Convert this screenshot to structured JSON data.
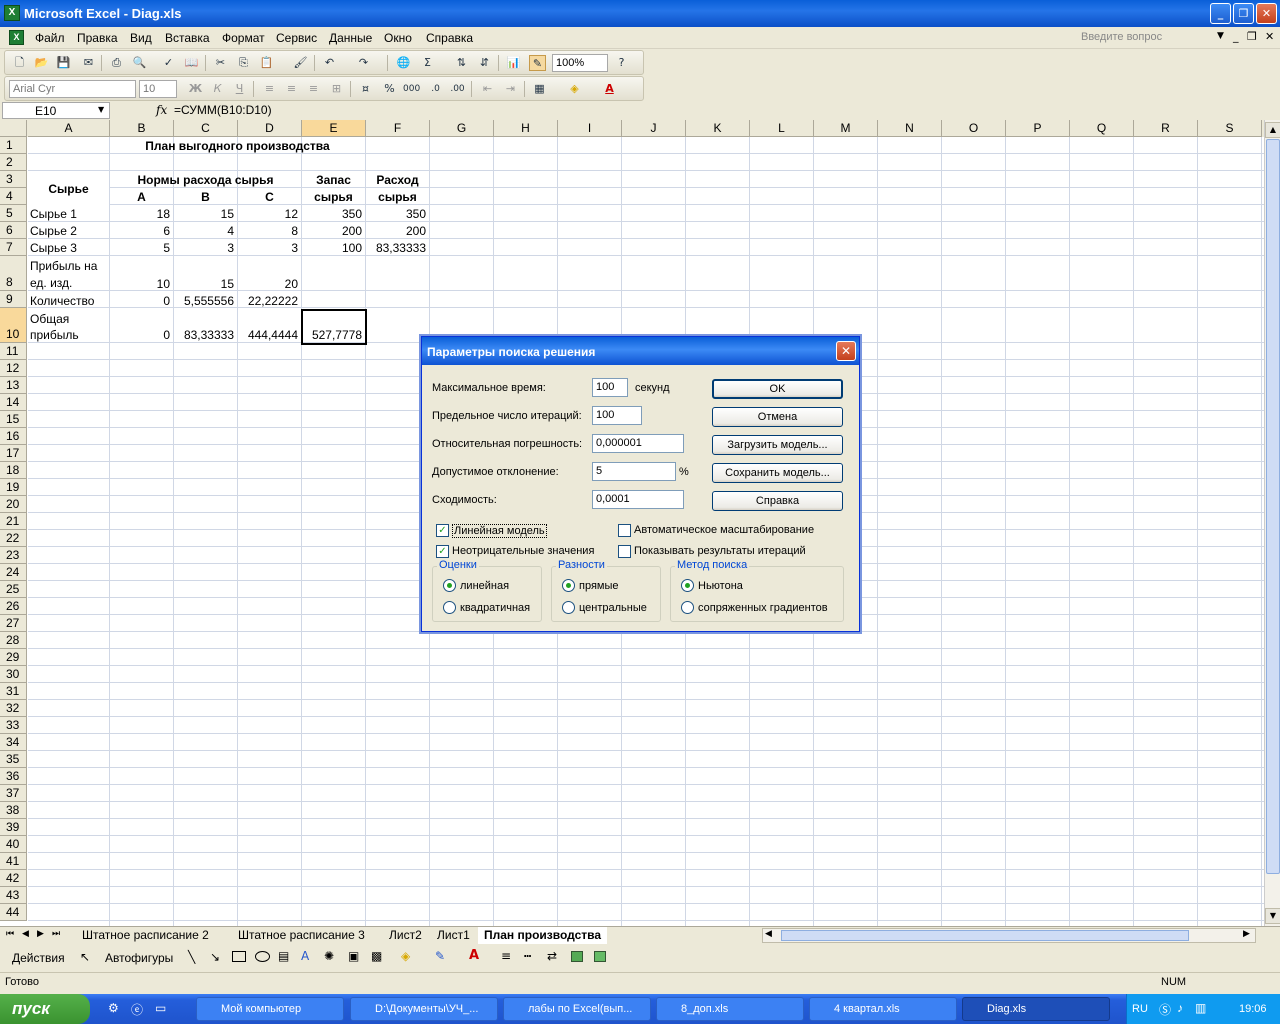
{
  "window": {
    "title": "Microsoft Excel - Diag.xls",
    "min": "_",
    "restore": "❐",
    "close": "✕"
  },
  "menu": {
    "items": [
      "Файл",
      "Правка",
      "Вид",
      "Вставка",
      "Формат",
      "Сервис",
      "Данные",
      "Окно",
      "Справка"
    ],
    "ask_placeholder": "Введите вопрос"
  },
  "toolbar": {
    "zoom": "100%",
    "font": "Arial Cyr",
    "size": "10",
    "bold": "Ж",
    "italic": "К",
    "underline": "Ч",
    "percent": "%",
    "thousands": "000",
    "sigma": "Σ"
  },
  "formula_bar": {
    "name_box": "E10",
    "fx": "fx",
    "formula": "=СУММ(B10:D10)"
  },
  "columns": [
    "A",
    "B",
    "C",
    "D",
    "E",
    "F",
    "G",
    "H",
    "I",
    "J",
    "K",
    "L",
    "M",
    "N",
    "O",
    "P",
    "Q",
    "R",
    "S"
  ],
  "rows": [
    "1",
    "2",
    "3",
    "4",
    "5",
    "6",
    "7",
    "8",
    "9",
    "10",
    "11",
    "12",
    "13",
    "14",
    "15",
    "16",
    "17",
    "18",
    "19",
    "20",
    "21",
    "22",
    "23",
    "24",
    "25",
    "26",
    "27",
    "28",
    "29",
    "30",
    "31",
    "32",
    "33",
    "34",
    "35",
    "36",
    "37",
    "38",
    "39",
    "40",
    "41",
    "42",
    "43",
    "44"
  ],
  "sheet": {
    "title": "План выгодного производства",
    "raw_header": "Сырье",
    "norms_header": "Нормы расхода сырья",
    "prod_a": "A",
    "prod_b": "B",
    "prod_c": "C",
    "stock_header_1": "Запас",
    "stock_header_2": "сырья",
    "usage_header_1": "Расход",
    "usage_header_2": "сырья",
    "r5": [
      "Сырье 1",
      "18",
      "15",
      "12",
      "350",
      "350"
    ],
    "r6": [
      "Сырье 2",
      "6",
      "4",
      "8",
      "200",
      "200"
    ],
    "r7": [
      "Сырье 3",
      "5",
      "3",
      "3",
      "100",
      "83,33333"
    ],
    "r8_label_1": "Прибыль на",
    "r8_label_2": "ед. изд.",
    "r8": [
      "10",
      "15",
      "20"
    ],
    "r9_label": "Количество",
    "r9": [
      "0",
      "5,555556",
      "22,22222"
    ],
    "r10_label_1": "Общая",
    "r10_label_2": "прибыль",
    "r10": [
      "0",
      "83,33333",
      "444,4444",
      "527,7778"
    ]
  },
  "sheet_tabs": [
    "Штатное расписание 2",
    "Штатное расписание 3",
    "Лист2",
    "Лист1",
    "План производства"
  ],
  "drawing": {
    "actions": "Действия",
    "autoshapes": "Автофигуры"
  },
  "status": {
    "ready": "Готово",
    "num": "NUM"
  },
  "taskbar": {
    "start": "пуск",
    "tasks": [
      "Мой компьютер",
      "D:\\Документы\\УЧ_...",
      "лабы по Excel(вып...",
      "8_доп.xls",
      "4 квартал.xls",
      "Diag.xls"
    ],
    "lang": "RU",
    "time": "19:06"
  },
  "dialog": {
    "title": "Параметры поиска решения",
    "max_time_label": "Максимальное время:",
    "max_time": "100",
    "seconds": "секунд",
    "iterations_label": "Предельное число итераций:",
    "iterations": "100",
    "precision_label": "Относительная погрешность:",
    "precision": "0,000001",
    "tolerance_label": "Допустимое отклонение:",
    "tolerance": "5",
    "pct": "%",
    "convergence_label": "Сходимость:",
    "convergence": "0,0001",
    "ok": "OK",
    "cancel": "Отмена",
    "load": "Загрузить модель...",
    "save": "Сохранить модель...",
    "help": "Справка",
    "linear_model": "Линейная модель",
    "auto_scale": "Автоматическое масштабирование",
    "nonneg": "Неотрицательные значения",
    "show_iter": "Показывать результаты итераций",
    "estimates": "Оценки",
    "est_linear": "линейная",
    "est_quad": "квадратичная",
    "derivs": "Разности",
    "der_forward": "прямые",
    "der_central": "центральные",
    "search": "Метод поиска",
    "search_newton": "Ньютона",
    "search_cg": "сопряженных градиентов",
    "linear_model_checked": true,
    "nonneg_checked": true,
    "auto_scale_checked": false,
    "show_iter_checked": false
  }
}
